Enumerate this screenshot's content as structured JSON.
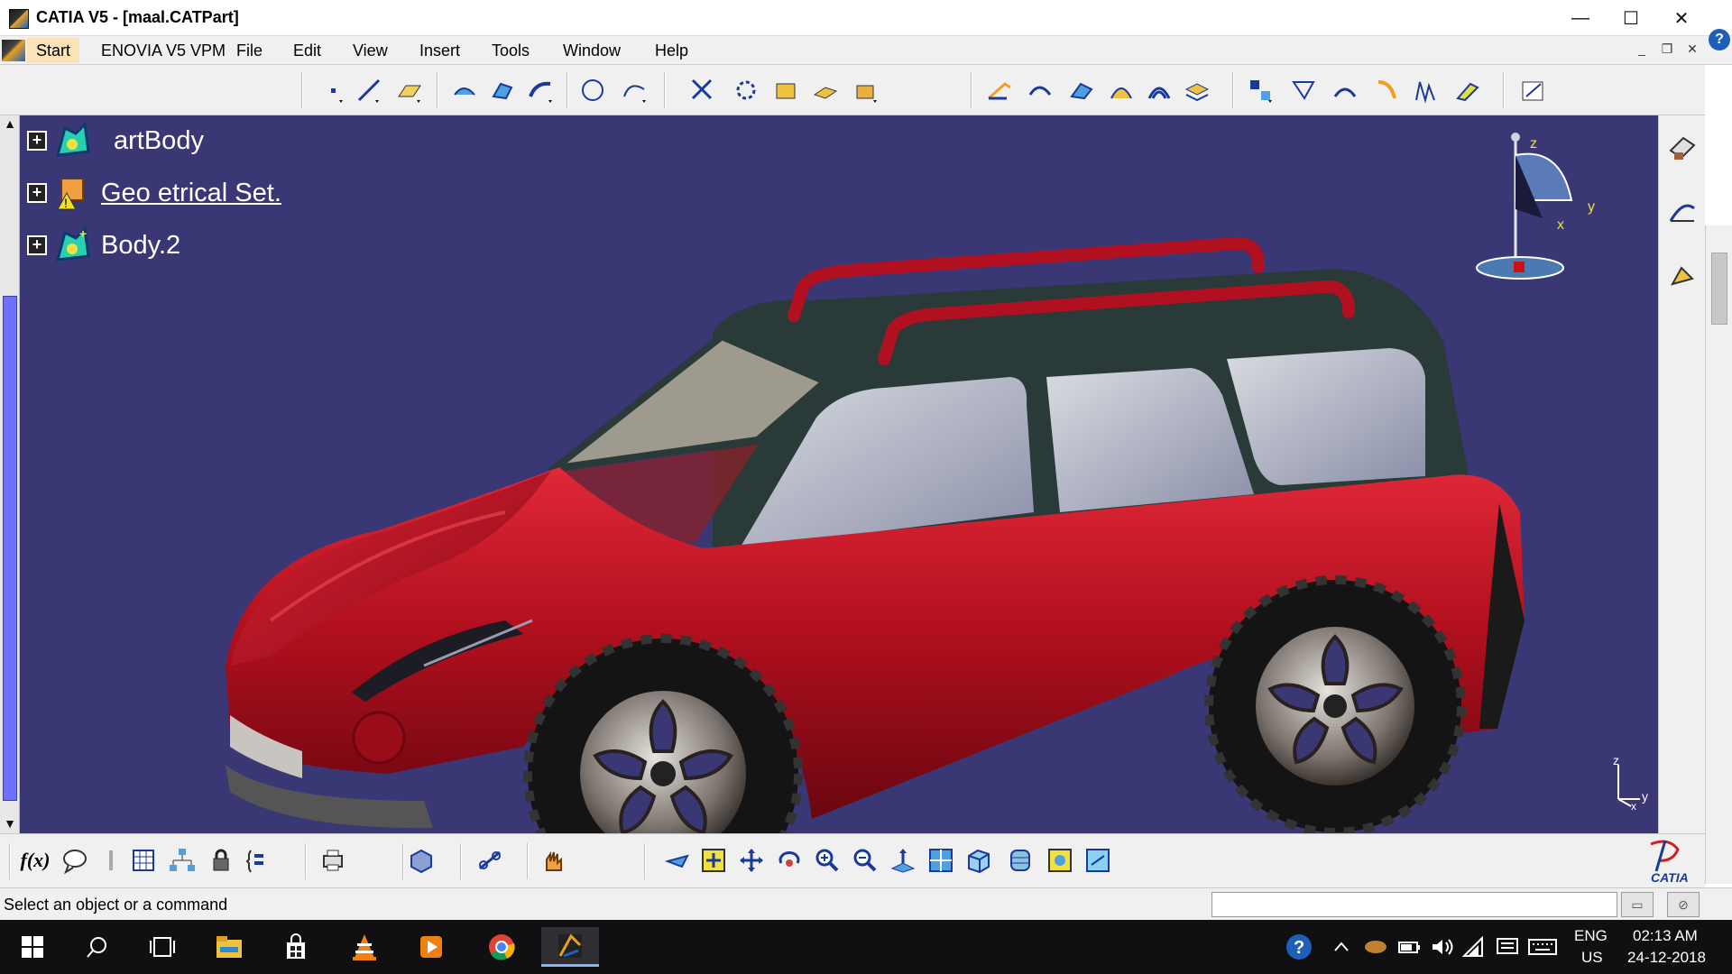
{
  "window": {
    "title": "CATIA V5 - [maal.CATPart]",
    "minimize": "—",
    "maximize": "☐",
    "close": "✕"
  },
  "menu": {
    "start": "Start",
    "items": [
      "ENOVIA V5 VPM",
      "File",
      "Edit",
      "View",
      "Insert",
      "Tools",
      "Window",
      "Help"
    ],
    "mdi": {
      "minimize": "_",
      "restore": "❐",
      "close": "✕"
    },
    "help_badge": "?"
  },
  "tree": {
    "items": [
      {
        "label": "artBody",
        "expander": "+"
      },
      {
        "label": "Geo    etrical Set.",
        "expander": "+"
      },
      {
        "label": "Body.2",
        "expander": "+"
      }
    ]
  },
  "compass": {
    "z": "z",
    "y": "y",
    "x": "x"
  },
  "axis_triad": {
    "z": "z",
    "y": "y",
    "x": "x"
  },
  "scroll": {
    "up": "▲",
    "down": "▼"
  },
  "bottom_toolbar": {
    "fx_label": "f(x)"
  },
  "catia_logo": {
    "text": "CATIA"
  },
  "status": {
    "message": "Select an object or a command",
    "command_value": ""
  },
  "taskbar": {
    "language_top": "ENG",
    "language_bottom": "US",
    "time": "02:13 AM",
    "date": "24-12-2018",
    "help_badge": "?"
  },
  "colors": {
    "viewport_bg": "#3a3775",
    "car_body": "#b3101e",
    "car_roof": "#2a3a38",
    "menu_start_highlight": "#fbe3b8"
  }
}
